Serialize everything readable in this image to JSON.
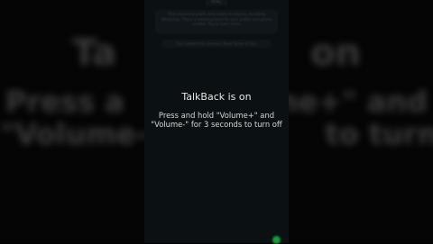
{
  "background": {
    "line1": "Ta",
    "line1_right": "on",
    "line2": "Press a",
    "line2_right": "ne+\" and",
    "line3": "\"Volume-\"",
    "line3_right": "to turn off"
  },
  "chat": {
    "date_badge": "today",
    "channel_notice": "This channel is public and visible to anyone, including WhatsApp. There is added privacy for your profile and phone number. Tap to learn more.",
    "created_notice": "You created this channel. Read Terms of Use"
  },
  "talkback": {
    "title": "TalkBack is on",
    "body_line1": "Press and hold \"Volume+\" and",
    "body_line2": "\"Volume-\" for 3 seconds to turn off"
  },
  "colors": {
    "screen_bg": "#1f2b31",
    "bubble_bg": "#2c3d45",
    "indicator": "#1fbf4a"
  }
}
